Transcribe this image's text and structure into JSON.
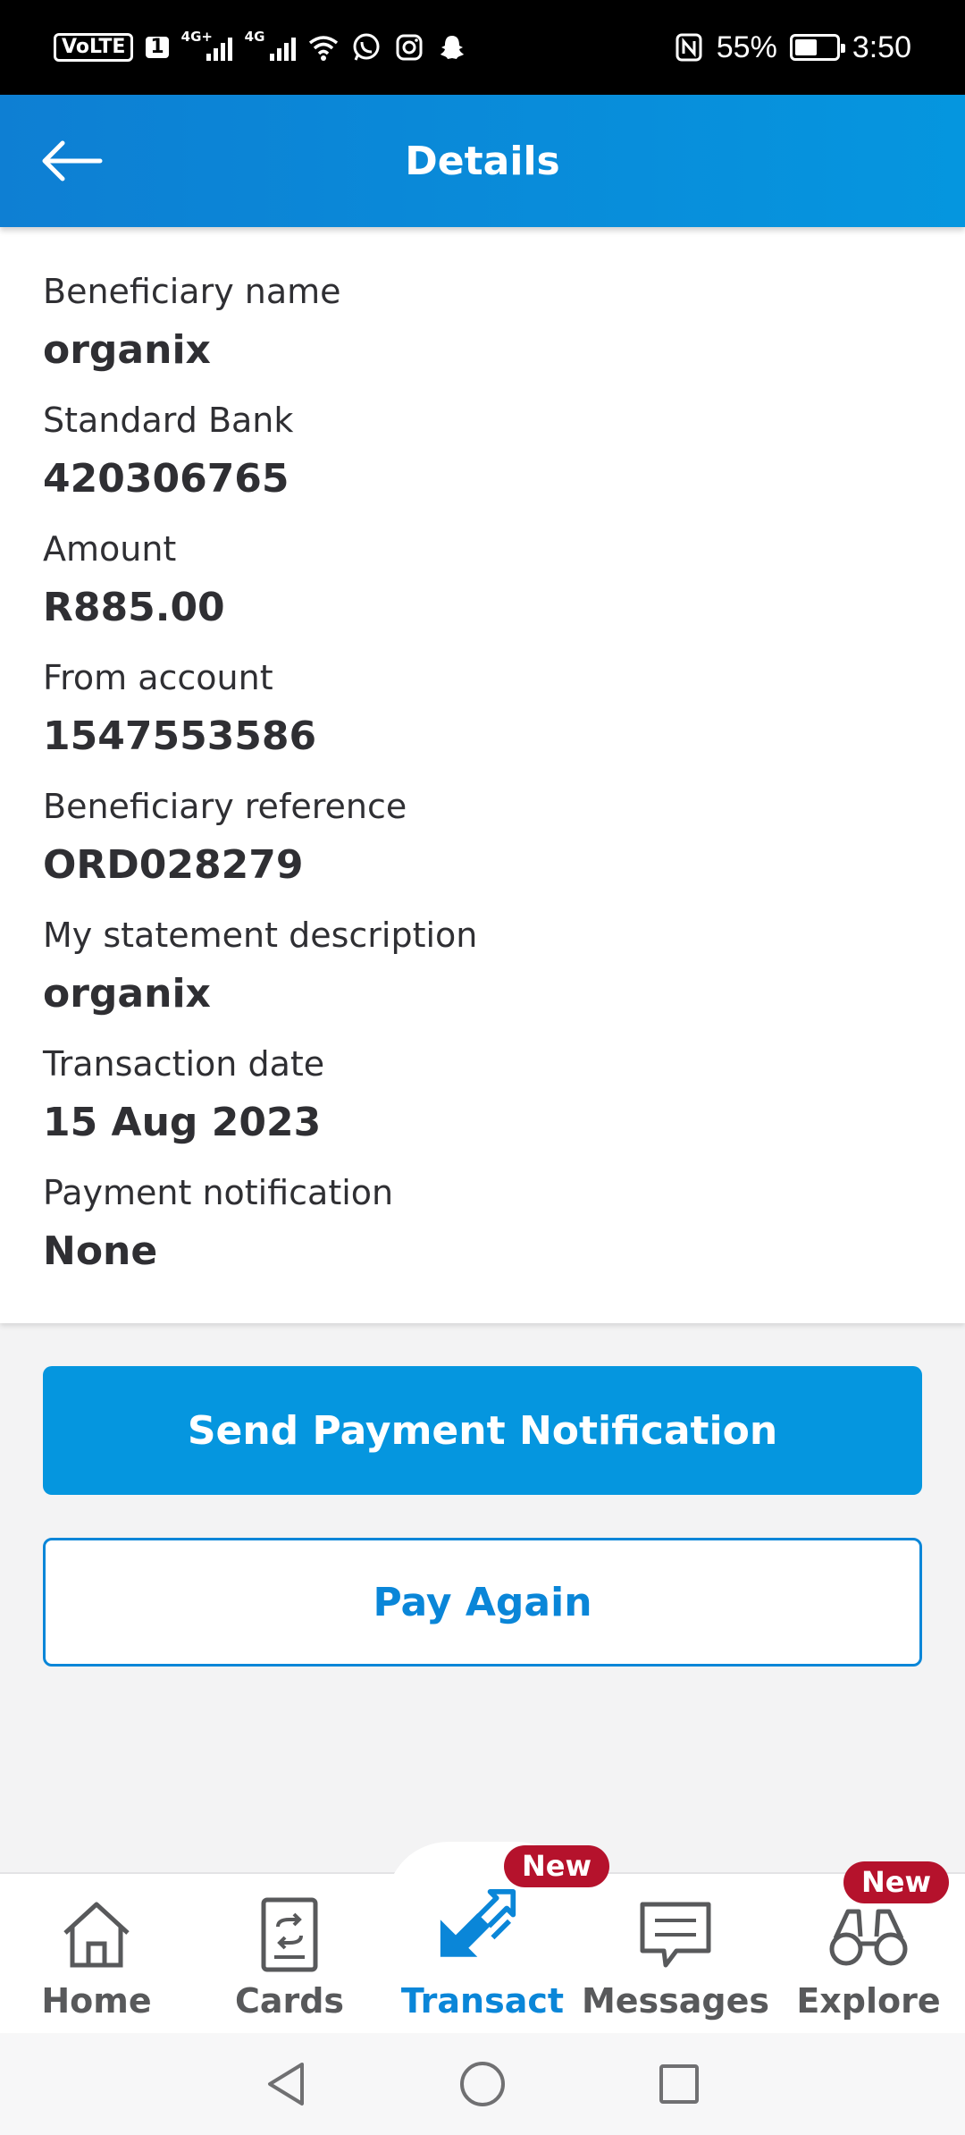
{
  "status_bar": {
    "volte": "VoLTE",
    "sim": "1",
    "net1": "4G+",
    "net2": "4G",
    "battery_percent": "55%",
    "time": "3:50",
    "battery_level": 0.55
  },
  "header": {
    "title": "Details"
  },
  "details": [
    {
      "label": "Beneficiary name",
      "value": "organix"
    },
    {
      "label": "Standard Bank",
      "value": "420306765"
    },
    {
      "label": "Amount",
      "value": "R885.00"
    },
    {
      "label": "From account",
      "value": "1547553586"
    },
    {
      "label": "Beneficiary reference",
      "value": "ORD028279"
    },
    {
      "label": "My statement description",
      "value": "organix"
    },
    {
      "label": "Transaction date",
      "value": "15 Aug 2023"
    },
    {
      "label": "Payment notification",
      "value": "None"
    }
  ],
  "actions": {
    "primary": "Send Payment Notification",
    "secondary": "Pay Again"
  },
  "bottom_nav": {
    "items": [
      {
        "label": "Home",
        "icon": "home-icon"
      },
      {
        "label": "Cards",
        "icon": "card-icon"
      },
      {
        "label": "Transact",
        "icon": "transact-arrows-icon",
        "badge": "New",
        "active": true
      },
      {
        "label": "Messages",
        "icon": "message-icon"
      },
      {
        "label": "Explore",
        "icon": "binoculars-icon",
        "badge": "New"
      }
    ]
  },
  "colors": {
    "brand_blue": "#0596df",
    "header_blue": "#0e7fd3",
    "badge_red": "#b5122c",
    "text_dark": "#2f2f33",
    "nav_gray": "#58595b"
  }
}
